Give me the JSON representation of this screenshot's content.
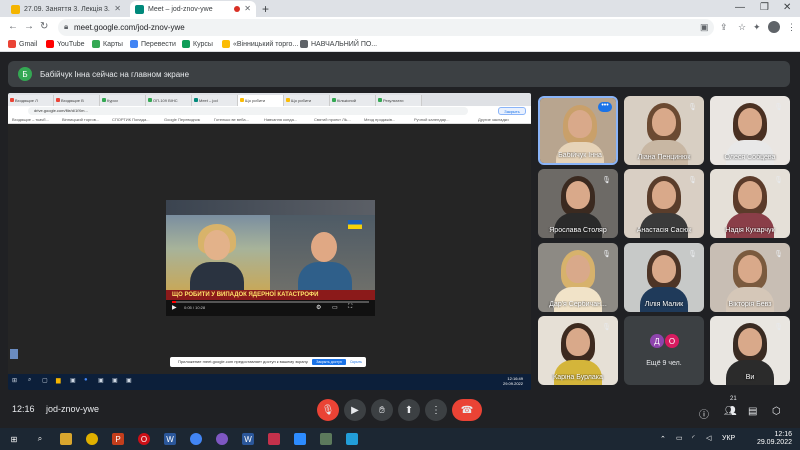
{
  "browser": {
    "tabs": [
      {
        "title": "27.09. Заняття 3. Лекція 3.",
        "favicon_color": "#f4b400"
      },
      {
        "title": "Meet – jod-znov-ywe",
        "favicon_color": "#00897b"
      }
    ],
    "new_tab": "+",
    "url": "meet.google.com/jod-znov-ywe",
    "bookmarks": [
      {
        "label": "Gmail",
        "color": "#ea4335"
      },
      {
        "label": "YouTube",
        "color": "#ff0000"
      },
      {
        "label": "Карты",
        "color": "#34a853"
      },
      {
        "label": "Перевести",
        "color": "#4285f4"
      },
      {
        "label": "Курсы",
        "color": "#0f9d58"
      },
      {
        "label": "«Вінницький торго...",
        "color": "#fbbc05"
      },
      {
        "label": "НАВЧАЛЬНИЙ ПО...",
        "color": "#5f6368"
      }
    ]
  },
  "meet": {
    "presenter_initial": "Б",
    "presenter_text": "Бабійчук Інна сейчас на главном экране",
    "shared_screen": {
      "tabs": [
        "Входящие Л",
        "Входящие В",
        "Курси",
        "ОП-109 ВІНС",
        "Meet – jod",
        "Що робити",
        "Що робити",
        "Кількісний",
        "Результати"
      ],
      "address": "drive.google.com/file/d/1fXm...",
      "address_button": "Закрыть",
      "bookmarks": [
        "Входящие – ткачб...",
        "Вінницький торгов...",
        "СПОРТИК Попада...",
        "Google Переводчик",
        "Готелько ве веба...",
        "Навчання конда...",
        "Святий проект ЛЬ...",
        "Меод продажів...",
        "Ручной календар...",
        "Другие закладки"
      ],
      "video_caption": "ЩО РОБИТИ У ВИПАДОК ЯДЕРНОЇ КАТАСТРОФИ",
      "video_time": "0:05 / 10:28",
      "video_progress": 0.02,
      "notification": "Приложение meet.google.com предоставляет доступ к вашему экрану.",
      "notification_btn1": "Закрыть доступ",
      "notification_btn2": "Скрыть",
      "clock_time": "12:16:49",
      "clock_date": "29.09.2022"
    },
    "participants": [
      {
        "name": "Бабійчук Інна",
        "active": true,
        "hair": "#c9a06a",
        "torso": "#e6d3b8",
        "bg": "#b8a58f"
      },
      {
        "name": "Ліана Пенцинюк",
        "hair": "#6b4a32",
        "torso": "#c8b7a3",
        "bg": "#d8cfc3"
      },
      {
        "name": "Олеся Собцева",
        "hair": "#4a3022",
        "torso": "#e8e8e8",
        "bg": "#eae6e2"
      },
      {
        "name": "Ярослава Столяр",
        "hair": "#3b2a20",
        "torso": "#2a2a2a",
        "bg": "#6d6a66"
      },
      {
        "name": "Анастасія Сасюк",
        "hair": "#5a3d2b",
        "torso": "#3a3a3a",
        "bg": "#d9cfc4"
      },
      {
        "name": "Надія Кухарчук",
        "hair": "#5b3b2a",
        "torso": "#8a3e48",
        "bg": "#e5e0d8"
      },
      {
        "name": "Дар'я Сербичан...",
        "hair": "#d7b26c",
        "torso": "#f1e3c8",
        "bg": "#8d8a84"
      },
      {
        "name": "Лілія Малик",
        "hair": "#4d3426",
        "torso": "#1f3a5a",
        "bg": "#c7c9c8"
      },
      {
        "name": "Вікторія Бевз",
        "hair": "#7a5a3e",
        "torso": "#d5c7b8",
        "bg": "#c8beb4"
      },
      {
        "name": "Каріна Бурлака",
        "hair": "#3d2a1f",
        "torso": "#d4b53a",
        "bg": "#e6e0d6"
      },
      {
        "name": "Ви",
        "hair": "#3a2b22",
        "torso": "#2b2b2b",
        "bg": "#e9e6e1"
      }
    ],
    "more": {
      "label": "Ещё 9 чел.",
      "avatars": [
        {
          "letter": "Д",
          "color": "#8e44ad"
        },
        {
          "letter": "О",
          "color": "#d81b60"
        }
      ]
    },
    "bottom": {
      "time": "12:16",
      "code": "jod-znov-ywe",
      "people_count": "21"
    }
  },
  "taskbar": {
    "lang": "УКР",
    "time": "12:16",
    "date": "29.09.2022"
  }
}
